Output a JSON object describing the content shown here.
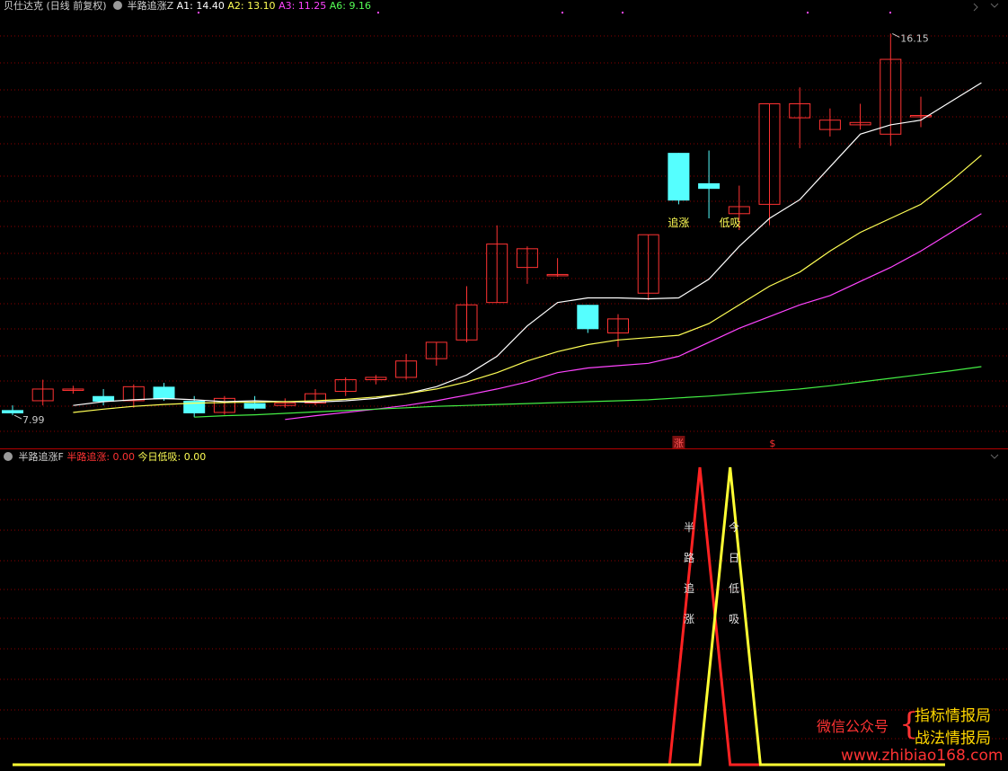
{
  "header": {
    "symbol_label": "贝仕达克 (日线 前复权)",
    "indicator_name": "半路追涨Z",
    "readouts": [
      {
        "label": "A1: 14.40",
        "color": "#ffffff"
      },
      {
        "label": "A2: 13.10",
        "color": "#ffff55"
      },
      {
        "label": "A3: 11.25",
        "color": "#ff44ff"
      },
      {
        "label": "A6: 9.16",
        "color": "#55ff55"
      }
    ]
  },
  "sub_header": {
    "indicator_name": "半路追涨F",
    "readouts": [
      {
        "label": "半路追涨: 0.00",
        "color": "#ff3333"
      },
      {
        "label": "今日低吸: 0.00",
        "color": "#ffff55"
      }
    ]
  },
  "price_labels": {
    "high": "16.15",
    "low": "7.99"
  },
  "signal_labels": {
    "chase": "追涨",
    "dip": "低吸",
    "marker_zhang": "涨",
    "marker_s": "$"
  },
  "sub_labels": {
    "chase_chars": [
      "半",
      "路",
      "追",
      "涨"
    ],
    "dip_chars": [
      "今",
      "日",
      "低",
      "吸"
    ]
  },
  "watermark": {
    "wechat": "微信公众号",
    "brace": "{",
    "name1": "指标情报局",
    "name2": "战法情报局",
    "url": "www.zhibiao168.com"
  },
  "colors": {
    "up": "#ff3333",
    "down": "#55ffff",
    "ma1": "#ffffff",
    "ma2": "#ffff55",
    "ma3": "#ff44ff",
    "ma6": "#44ee44",
    "grid": "#8b0000",
    "signal_red": "#ff2222",
    "signal_yellow": "#ffff33"
  },
  "chart_data": [
    {
      "type": "candlestick",
      "title": "半路追涨Z",
      "y_range": [
        7.3,
        16.6
      ],
      "candles": [
        {
          "o": 8.1,
          "h": 8.2,
          "l": 7.99,
          "c": 8.05
        },
        {
          "o": 8.3,
          "h": 8.75,
          "l": 8.2,
          "c": 8.55
        },
        {
          "o": 8.55,
          "h": 8.62,
          "l": 8.45,
          "c": 8.55
        },
        {
          "o": 8.4,
          "h": 8.55,
          "l": 8.2,
          "c": 8.3
        },
        {
          "o": 8.3,
          "h": 8.65,
          "l": 8.15,
          "c": 8.6
        },
        {
          "o": 8.6,
          "h": 8.68,
          "l": 8.3,
          "c": 8.35
        },
        {
          "o": 8.3,
          "h": 8.4,
          "l": 7.95,
          "c": 8.05
        },
        {
          "o": 8.05,
          "h": 8.4,
          "l": 8.0,
          "c": 8.35
        },
        {
          "o": 8.25,
          "h": 8.4,
          "l": 8.1,
          "c": 8.15
        },
        {
          "o": 8.2,
          "h": 8.35,
          "l": 8.15,
          "c": 8.25
        },
        {
          "o": 8.25,
          "h": 8.55,
          "l": 8.2,
          "c": 8.45
        },
        {
          "o": 8.5,
          "h": 8.8,
          "l": 8.4,
          "c": 8.75
        },
        {
          "o": 8.75,
          "h": 8.85,
          "l": 8.65,
          "c": 8.8
        },
        {
          "o": 8.8,
          "h": 9.3,
          "l": 8.75,
          "c": 9.15
        },
        {
          "o": 9.2,
          "h": 9.55,
          "l": 9.05,
          "c": 9.55
        },
        {
          "o": 9.6,
          "h": 10.75,
          "l": 9.55,
          "c": 10.35
        },
        {
          "o": 10.4,
          "h": 12.05,
          "l": 10.4,
          "c": 11.65
        },
        {
          "o": 11.15,
          "h": 11.6,
          "l": 10.8,
          "c": 11.55
        },
        {
          "o": 11.0,
          "h": 11.35,
          "l": 10.95,
          "c": 11.0
        },
        {
          "o": 10.35,
          "h": 10.35,
          "l": 9.75,
          "c": 9.85
        },
        {
          "o": 9.75,
          "h": 10.15,
          "l": 9.45,
          "c": 10.05
        },
        {
          "o": 10.6,
          "h": 11.85,
          "l": 10.45,
          "c": 11.85
        },
        {
          "o": 13.6,
          "h": 13.6,
          "l": 12.5,
          "c": 12.6
        },
        {
          "o": 12.95,
          "h": 13.65,
          "l": 12.2,
          "c": 12.85
        },
        {
          "o": 12.3,
          "h": 12.9,
          "l": 11.95,
          "c": 12.45
        },
        {
          "o": 12.5,
          "h": 14.65,
          "l": 12.05,
          "c": 14.65
        },
        {
          "o": 14.35,
          "h": 15.0,
          "l": 13.7,
          "c": 14.65
        },
        {
          "o": 14.1,
          "h": 14.55,
          "l": 13.95,
          "c": 14.3
        },
        {
          "o": 14.2,
          "h": 14.65,
          "l": 14.1,
          "c": 14.25
        },
        {
          "o": 14.0,
          "h": 16.15,
          "l": 13.75,
          "c": 15.6
        },
        {
          "o": 14.4,
          "h": 14.8,
          "l": 14.15,
          "c": 14.4
        }
      ],
      "series": [
        {
          "name": "A1",
          "color": "#ffffff",
          "start": 2,
          "values": [
            8.2,
            8.28,
            8.32,
            8.35,
            8.32,
            8.28,
            8.3,
            8.28,
            8.27,
            8.3,
            8.35,
            8.45,
            8.6,
            8.85,
            9.25,
            9.9,
            10.4,
            10.5,
            10.5,
            10.48,
            10.5,
            10.9,
            11.6,
            12.2,
            12.6,
            13.3,
            14.0,
            14.2,
            14.3,
            14.7,
            15.1
          ]
        },
        {
          "name": "A2",
          "color": "#ffff55",
          "start": 2,
          "values": [
            8.05,
            8.12,
            8.18,
            8.22,
            8.25,
            8.26,
            8.27,
            8.28,
            8.3,
            8.33,
            8.38,
            8.45,
            8.55,
            8.7,
            8.9,
            9.15,
            9.35,
            9.5,
            9.6,
            9.65,
            9.7,
            9.95,
            10.35,
            10.75,
            11.05,
            11.5,
            11.9,
            12.2,
            12.5,
            13.0,
            13.55
          ]
        },
        {
          "name": "A3",
          "color": "#ff44ff",
          "start": 9,
          "values": [
            7.9,
            7.98,
            8.05,
            8.12,
            8.2,
            8.3,
            8.42,
            8.55,
            8.7,
            8.9,
            9.0,
            9.05,
            9.1,
            9.25,
            9.55,
            9.85,
            10.1,
            10.35,
            10.55,
            10.85,
            11.15,
            11.5,
            11.9,
            12.3
          ]
        },
        {
          "name": "A6",
          "color": "#44ee44",
          "start": 6,
          "values": [
            7.95,
            7.98,
            8.0,
            8.03,
            8.06,
            8.09,
            8.12,
            8.15,
            8.18,
            8.2,
            8.22,
            8.24,
            8.26,
            8.28,
            8.3,
            8.32,
            8.36,
            8.4,
            8.45,
            8.5,
            8.55,
            8.62,
            8.7,
            8.78,
            8.86,
            8.94,
            9.03
          ]
        }
      ]
    },
    {
      "type": "line",
      "title": "半路追涨F",
      "y_range": [
        0,
        1
      ],
      "series": [
        {
          "name": "半路追涨",
          "color": "#ff2222",
          "points": [
            [
              0,
              0
            ],
            [
              21.7,
              0
            ],
            [
              22.7,
              1
            ],
            [
              23.7,
              0
            ],
            [
              30.8,
              0
            ]
          ]
        },
        {
          "name": "今日低吸",
          "color": "#ffff33",
          "points": [
            [
              0,
              0
            ],
            [
              22.7,
              0
            ],
            [
              23.7,
              1
            ],
            [
              24.7,
              0
            ],
            [
              30.8,
              0
            ]
          ]
        }
      ]
    }
  ]
}
